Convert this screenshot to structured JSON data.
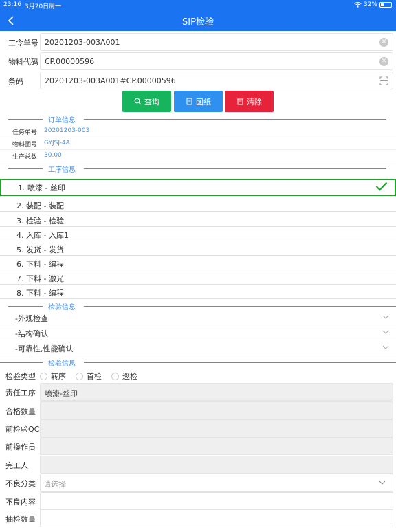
{
  "status_bar": {
    "time": "23:16",
    "date": "3月20日周一",
    "battery": "32%",
    "battery_level": 0.32
  },
  "nav": {
    "title": "SIP检验"
  },
  "form": {
    "work_order_label": "工令单号",
    "work_order_value": "20201203-003A001",
    "material_label": "物料代码",
    "material_value": "CP.00000596",
    "barcode_label": "条码",
    "barcode_value": "20201203-003A001#CP.00000596"
  },
  "buttons": {
    "query": "查询",
    "drawing": "图纸",
    "clear": "清除"
  },
  "colors": {
    "primary": "#1a73f0",
    "query": "#17b45e",
    "drawing": "#2f90ef",
    "clear": "#e6233a",
    "active_border": "#22a02b",
    "section": "#4a90e2"
  },
  "order_info": {
    "title": "订单信息",
    "task_label": "任务单号:",
    "task_value": "20201203-003",
    "figure_label": "物料图号:",
    "figure_value": "GYJSJ-4A",
    "total_label": "生产总数:",
    "total_value": "30.00"
  },
  "process_info": {
    "title": "工序信息",
    "items": [
      "1. 喷漆 - 丝印",
      "2. 装配 - 装配",
      "3. 检验 - 检验",
      "4. 入库 - 入库1",
      "5. 发货 - 发货",
      "6. 下料 - 编程",
      "7. 下料 - 激光",
      "8. 下料 - 编程"
    ]
  },
  "inspection_items": {
    "title": "检验信息",
    "items": [
      "-外观检查",
      "-结构确认",
      "-可靠性,性能确认"
    ]
  },
  "inspection_form": {
    "title": "检验信息",
    "type_label": "检验类型",
    "type_options": [
      "转序",
      "首检",
      "巡检"
    ],
    "resp_label": "责任工序",
    "resp_value": "喷漆-丝印",
    "qualified_label": "合格数量",
    "qc_label": "前检验QC",
    "prev_operator_label": "前操作员",
    "finisher_label": "完工人",
    "defect_type_label": "不良分类",
    "defect_type_placeholder": "请选择",
    "defect_content_label": "不良内容",
    "sample_label": "抽检数量"
  }
}
